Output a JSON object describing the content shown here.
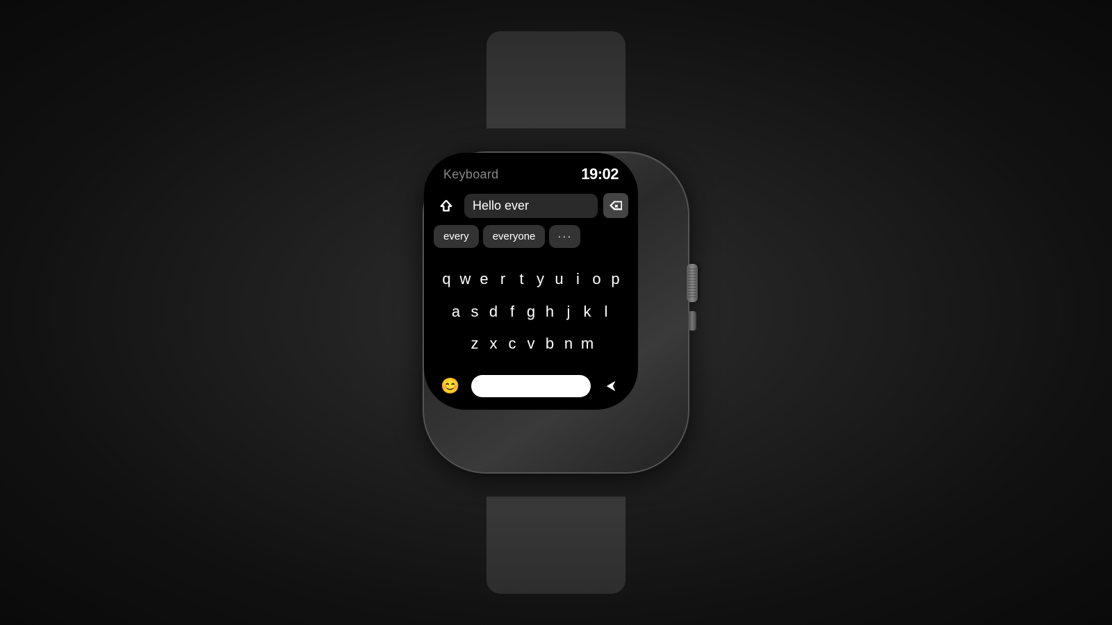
{
  "background": {
    "color": "#1a1a1a"
  },
  "watch": {
    "screen": {
      "status_bar": {
        "title": "Keyboard",
        "time": "19:02"
      },
      "input": {
        "text": "Hello ever",
        "shift_label": "⬆",
        "delete_label": "⌫"
      },
      "suggestions": [
        {
          "id": "s1",
          "label": "every"
        },
        {
          "id": "s2",
          "label": "everyone"
        },
        {
          "id": "s3",
          "label": "···"
        }
      ],
      "keyboard": {
        "row1": [
          "q",
          "w",
          "e",
          "r",
          "t",
          "y",
          "u",
          "i",
          "o",
          "p"
        ],
        "row2": [
          "a",
          "s",
          "d",
          "f",
          "g",
          "h",
          "j",
          "k",
          "l"
        ],
        "row3": [
          "z",
          "x",
          "c",
          "v",
          "b",
          "n",
          "m"
        ]
      },
      "bottom_bar": {
        "emoji_label": "😊",
        "send_label": "➤"
      }
    }
  }
}
